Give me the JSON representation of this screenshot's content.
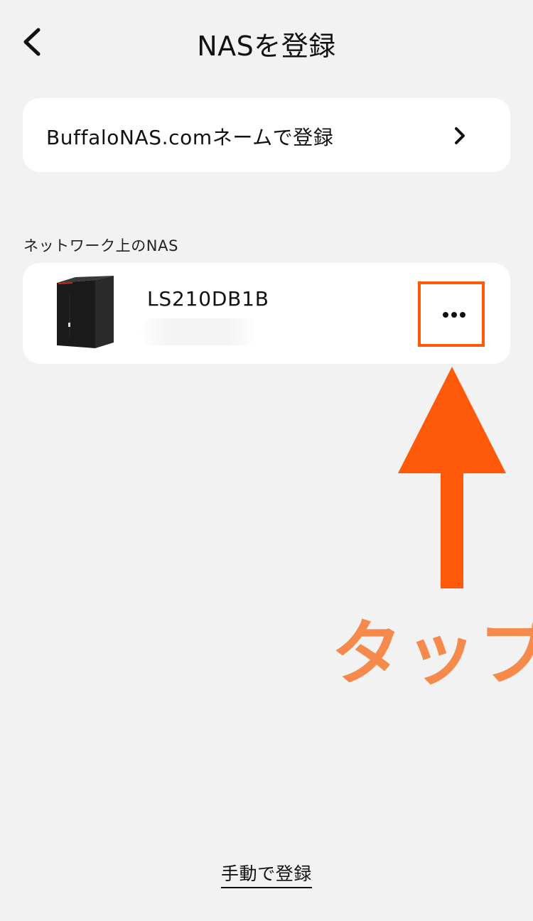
{
  "header": {
    "title": "NASを登録",
    "back_icon": "chevron-left-icon"
  },
  "buffalo_card": {
    "label": "BuffaloNAS.comネームで登録",
    "chevron_icon": "chevron-right-icon"
  },
  "network_section": {
    "label": "ネットワーク上のNAS",
    "devices": [
      {
        "name": "LS210DB1B",
        "image_icon": "nas-device-icon",
        "more_icon": "more-horizontal-icon"
      }
    ]
  },
  "annotation": {
    "text": "タップ",
    "color": "#f58a4c",
    "arrow_color": "#ff5a0a",
    "highlight_color": "#ff5a0a"
  },
  "footer": {
    "manual_label": "手動で登録"
  }
}
